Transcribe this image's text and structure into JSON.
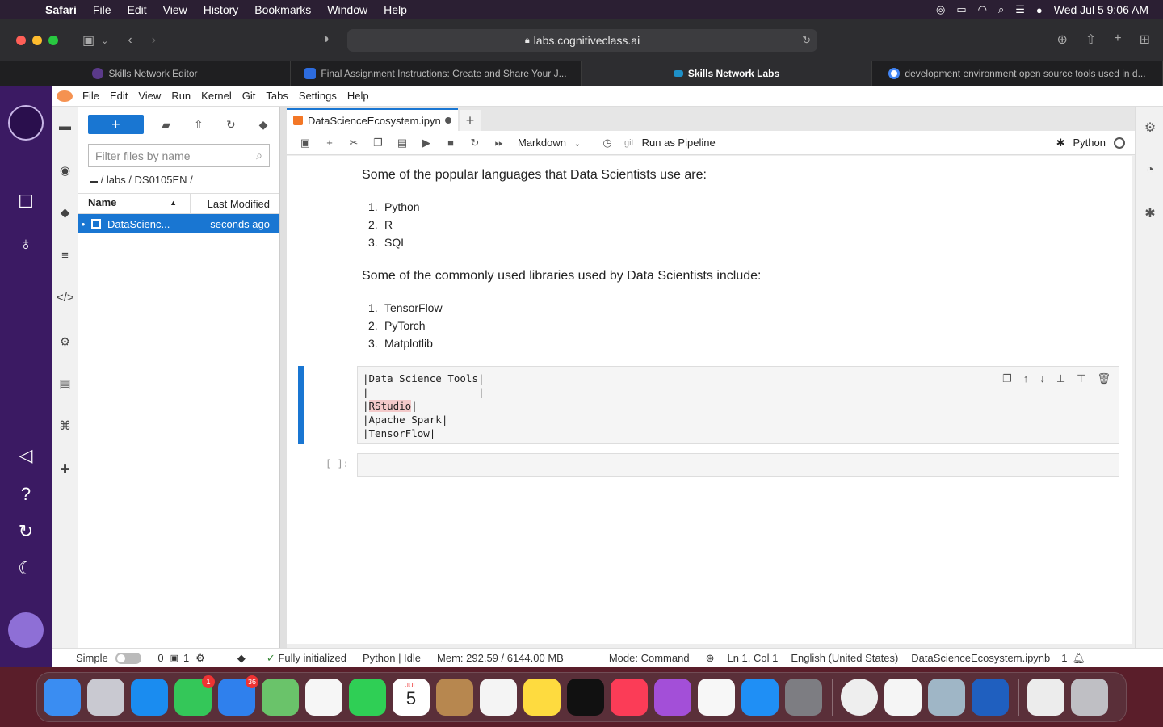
{
  "mac_menubar": {
    "app": "Safari",
    "items": [
      "File",
      "Edit",
      "View",
      "History",
      "Bookmarks",
      "Window",
      "Help"
    ],
    "clock": "Wed Jul 5  9:06 AM"
  },
  "safari": {
    "url": "labs.cognitiveclass.ai",
    "tabs": [
      {
        "label": "Skills Network Editor"
      },
      {
        "label": "Final Assignment Instructions: Create and Share Your J..."
      },
      {
        "label": "Skills Network Labs"
      },
      {
        "label": "development environment open source tools used in d..."
      }
    ]
  },
  "jupyter": {
    "menu": [
      "File",
      "Edit",
      "View",
      "Run",
      "Kernel",
      "Git",
      "Tabs",
      "Settings",
      "Help"
    ],
    "filebrowser": {
      "new_label": "+",
      "filter_placeholder": "Filter files by name",
      "breadcrumb": "/ labs / DS0105EN /",
      "col_name": "Name",
      "col_modified": "Last Modified",
      "files": [
        {
          "name": "DataScienc...",
          "modified": "seconds ago"
        }
      ]
    },
    "notebook": {
      "tab_title": "DataScienceEcosystem.ipyn",
      "cell_type": "Markdown",
      "git_label": "git",
      "run_pipeline": "Run as Pipeline",
      "kernel_name": "Python",
      "languages_intro": "Some of the popular languages that Data Scientists use are:",
      "languages": [
        "Python",
        "R",
        "SQL"
      ],
      "libraries_intro": "Some of the commonly used libraries used by Data Scientists include:",
      "libraries": [
        "TensorFlow",
        "PyTorch",
        "Matplotlib"
      ],
      "editor_lines": [
        "|Data Science Tools|",
        "|------------------|",
        "|",
        "RStudio",
        "|",
        "|Apache Spark|",
        "|TensorFlow|"
      ],
      "prompt": "[ ]:"
    },
    "status": {
      "mode_simple": "Simple",
      "terminals": "0",
      "kernels": "1",
      "git_status": "Fully initialized",
      "kernel_status": "Python | Idle",
      "mem": "Mem: 292.59 / 6144.00 MB",
      "mode": "Mode: Command",
      "cursor": "Ln 1, Col 1",
      "language": "English (United States)",
      "filename": "DataScienceEcosystem.ipynb",
      "notifications": "1"
    }
  },
  "dock": {
    "messages_badge": "1",
    "mail_badge": "36",
    "calendar_month": "JUL",
    "calendar_day": "5"
  },
  "colors": {
    "jupyter_blue": "#1976d2",
    "sidebar_purple": "#3b1a63",
    "highlight": "#f3c9c9"
  }
}
